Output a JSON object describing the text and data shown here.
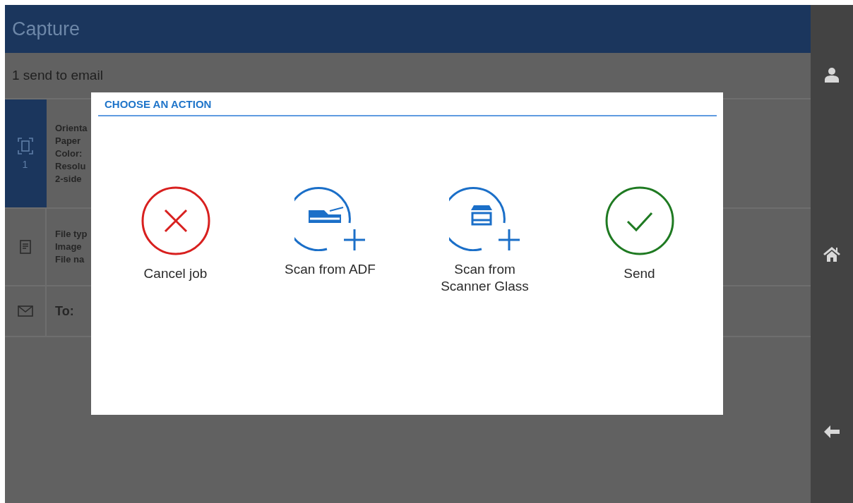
{
  "header": {
    "title": "Capture"
  },
  "subheader": "1 send to email",
  "job_rows": [
    {
      "kind": "scan",
      "selected": true,
      "count": "1",
      "lines": [
        "Orienta",
        "Paper",
        "Color:",
        "Resolu",
        "2-side"
      ]
    },
    {
      "kind": "file",
      "selected": false,
      "lines": [
        "File typ",
        "Image",
        "File na"
      ]
    },
    {
      "kind": "email",
      "selected": false,
      "lines": [
        "To:"
      ]
    }
  ],
  "dialog": {
    "title": "CHOOSE AN ACTION",
    "actions": [
      {
        "kind": "cancel",
        "label": "Cancel job"
      },
      {
        "kind": "adf",
        "label": "Scan from ADF"
      },
      {
        "kind": "glass",
        "label": "Scan from Scanner Glass"
      },
      {
        "kind": "send",
        "label": "Send"
      }
    ]
  },
  "sidebar": [
    {
      "kind": "user"
    },
    {
      "kind": "home"
    },
    {
      "kind": "back"
    }
  ]
}
